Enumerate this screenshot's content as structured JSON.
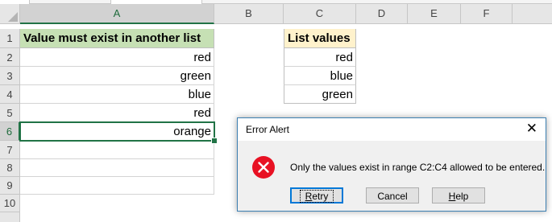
{
  "columns": [
    "A",
    "B",
    "C",
    "D",
    "E",
    "F"
  ],
  "rows": [
    "1",
    "2",
    "3",
    "4",
    "5",
    "6",
    "7",
    "8",
    "9",
    "10"
  ],
  "cells": {
    "A1": "Value must exist in another list",
    "A2": "red",
    "A3": "green",
    "A4": "blue",
    "A5": "red",
    "A6": "orange",
    "C1": "List values",
    "C2": "red",
    "C3": "blue",
    "C4": "green"
  },
  "colors": {
    "header_a_fill": "#c6e0b4",
    "header_c_fill": "#fff2cc",
    "selection_green": "#217346",
    "error_red": "#e81123"
  },
  "dialog": {
    "title": "Error Alert",
    "close_glyph": "✕",
    "icon": "error-circle-x-icon",
    "message": "Only the values exist in range C2:C4 allowed to be entered.",
    "buttons": {
      "retry_first": "R",
      "retry_rest": "etry",
      "cancel": "Cancel",
      "help_first": "H",
      "help_rest": "elp"
    }
  }
}
